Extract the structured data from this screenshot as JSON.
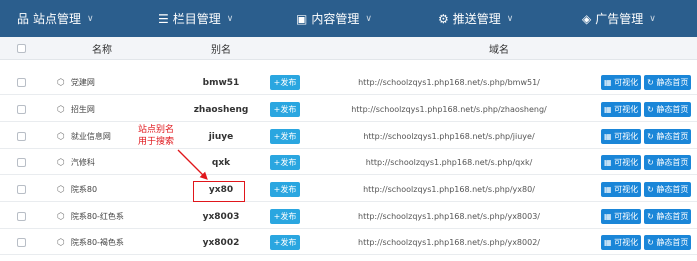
{
  "nav": {
    "items": [
      {
        "icon": "sitemap-icon",
        "glyph": "品",
        "label": "站点管理"
      },
      {
        "icon": "list-icon",
        "glyph": "☰",
        "label": "栏目管理"
      },
      {
        "icon": "content-icon",
        "glyph": "▣",
        "label": "内容管理"
      },
      {
        "icon": "push-icon",
        "glyph": "⚙",
        "label": "推送管理"
      },
      {
        "icon": "ad-icon",
        "glyph": "◈",
        "label": "广告管理"
      }
    ]
  },
  "table": {
    "headers": {
      "name": "名称",
      "alias": "别名",
      "domain": "域名"
    },
    "rows": [
      {
        "name": "党建网",
        "alias": "bmw51",
        "publish": "+发布",
        "url": "http://schoolzqys1.php168.net/s.php/bmw51/",
        "vis": "可视化",
        "static": "静态首页"
      },
      {
        "name": "招生网",
        "alias": "zhaosheng",
        "publish": "+发布",
        "url": "http://schoolzqys1.php168.net/s.php/zhaosheng/",
        "vis": "可视化",
        "static": "静态首页"
      },
      {
        "name": "就业信息网",
        "alias": "jiuye",
        "publish": "+发布",
        "url": "http://schoolzqys1.php168.net/s.php/jiuye/",
        "vis": "可视化",
        "static": "静态首页"
      },
      {
        "name": "汽修科",
        "alias": "qxk",
        "publish": "+发布",
        "url": "http://schoolzqys1.php168.net/s.php/qxk/",
        "vis": "可视化",
        "static": "静态首页"
      },
      {
        "name": "院系80",
        "alias": "yx80",
        "publish": "+发布",
        "url": "http://schoolzqys1.php168.net/s.php/yx80/",
        "vis": "可视化",
        "static": "静态首页"
      },
      {
        "name": "院系80-红色系",
        "alias": "yx8003",
        "publish": "+发布",
        "url": "http://schoolzqys1.php168.net/s.php/yx8003/",
        "vis": "可视化",
        "static": "静态首页"
      },
      {
        "name": "院系80-褐色系",
        "alias": "yx8002",
        "publish": "+发布",
        "url": "http://schoolzqys1.php168.net/s.php/yx8002/",
        "vis": "可视化",
        "static": "静态首页"
      }
    ]
  },
  "annotation": {
    "line1": "站点别名",
    "line2": "用于搜索"
  },
  "colors": {
    "nav_bg": "#2b5e8d",
    "publish": "#2aa6e0",
    "action": "#1a86d8",
    "annotation": "#e0161b"
  }
}
